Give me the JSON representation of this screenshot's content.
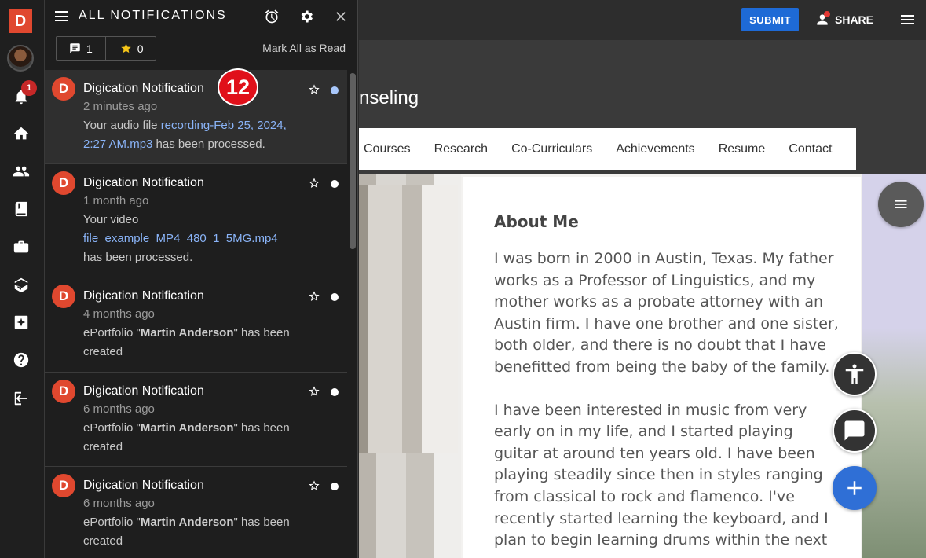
{
  "rail": {
    "logo": "D",
    "notification_badge": "1",
    "icons": [
      "avatar",
      "bell-icon",
      "home-icon",
      "people-icon",
      "book-icon",
      "briefcase-icon",
      "cards-icon",
      "sparkle-icon",
      "help-icon",
      "logout-icon"
    ]
  },
  "panel": {
    "title": "ALL NOTIFICATIONS",
    "comment_count": "1",
    "star_count": "0",
    "mark_all_read": "Mark All as Read",
    "callout": "12"
  },
  "notifications": [
    {
      "avatar": "D",
      "title": "Digication Notification",
      "time": "2 minutes ago",
      "msg_pre": "Your audio file ",
      "msg_link": "recording-Feb 25, 2024, 2:27 AM.mp3",
      "msg_post": " has been processed.",
      "unread": true
    },
    {
      "avatar": "D",
      "title": "Digication Notification",
      "time": "1 month ago",
      "msg_pre": "Your video",
      "msg_link": "file_example_MP4_480_1_5MG.mp4",
      "msg_post": "has been processed.",
      "unread": false
    },
    {
      "avatar": "D",
      "title": "Digication Notification",
      "time": "4 months ago",
      "msg_pre": "ePortfolio \"",
      "msg_bold": "Martin Anderson",
      "msg_post": "\" has been created",
      "unread": false
    },
    {
      "avatar": "D",
      "title": "Digication Notification",
      "time": "6 months ago",
      "msg_pre": "ePortfolio \"",
      "msg_bold": "Martin Anderson",
      "msg_post": "\" has been created",
      "unread": false
    },
    {
      "avatar": "D",
      "title": "Digication Notification",
      "time": "6 months ago",
      "msg_pre": "ePortfolio \"",
      "msg_bold": "Martin Anderson",
      "msg_post": "\" has been created",
      "unread": false
    }
  ],
  "topbar": {
    "submit": "SUBMIT",
    "share": "SHARE"
  },
  "site": {
    "title_partial": "nseling",
    "nav": [
      "Courses",
      "Research",
      "Co-Curriculars",
      "Achievements",
      "Resume",
      "Contact"
    ]
  },
  "about": {
    "heading": "About Me",
    "p1": "I was born in 2000 in Austin, Texas. My father works as a Professor of Linguistics, and my mother works as a probate attorney with an Austin firm. I have one brother and one sister, both older, and there is no doubt that I have benefitted from being the baby of the family.",
    "p2": "I have been interested in music from very early on in my life, and I started playing guitar at around ten years old. I have been playing steadily since then in styles ranging from classical to rock and flamenco. I've recently started learning the keyboard, and I plan to begin learning drums within the next year,"
  },
  "colors": {
    "brand": "#e0482f",
    "submit": "#1e6ad6",
    "link": "#8ab4f8",
    "badge": "#c62828",
    "callout": "#e0101a"
  }
}
